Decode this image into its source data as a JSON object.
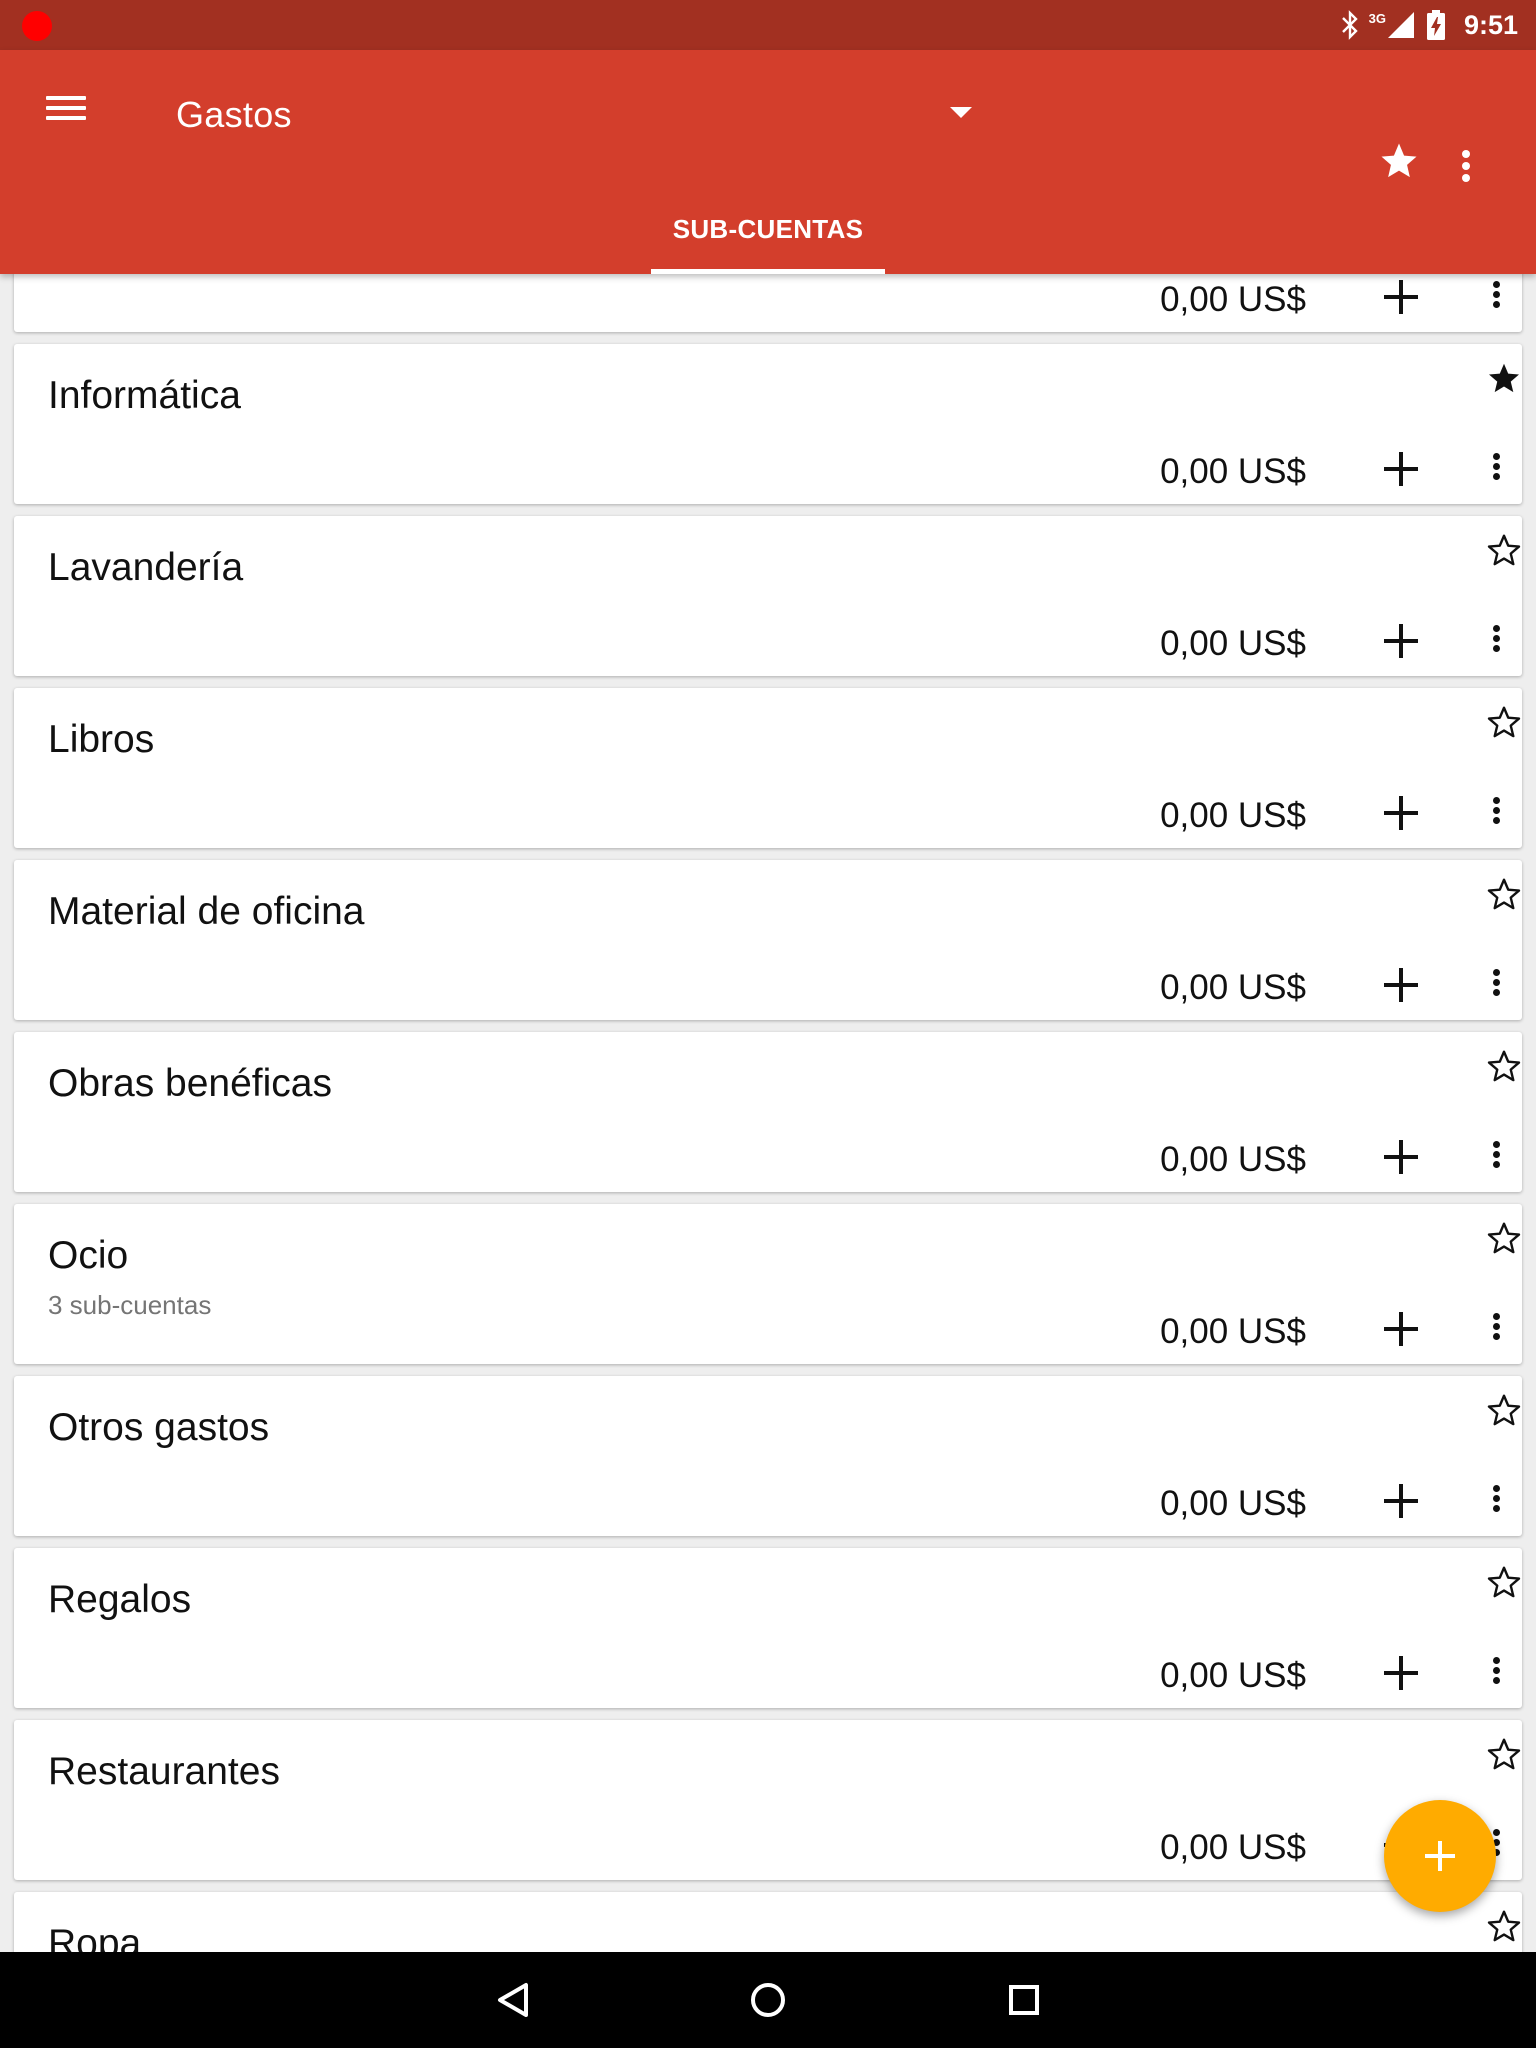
{
  "status_bar": {
    "time": "9:51",
    "network": "3G",
    "icons": [
      "recording-dot-icon",
      "bluetooth-icon",
      "signal-icon",
      "battery-charging-icon"
    ]
  },
  "app_bar": {
    "title": "Gastos",
    "icons": [
      "menu-icon",
      "dropdown-arrow-icon",
      "star-icon",
      "more-vert-icon"
    ],
    "tab": "SUB-CUENTAS"
  },
  "accounts": [
    {
      "name": "",
      "subtitle": "",
      "amount": "0,00 US$",
      "favorite": false
    },
    {
      "name": "Informática",
      "subtitle": "",
      "amount": "0,00 US$",
      "favorite": true
    },
    {
      "name": "Lavandería",
      "subtitle": "",
      "amount": "0,00 US$",
      "favorite": false
    },
    {
      "name": "Libros",
      "subtitle": "",
      "amount": "0,00 US$",
      "favorite": false
    },
    {
      "name": "Material de oficina",
      "subtitle": "",
      "amount": "0,00 US$",
      "favorite": false
    },
    {
      "name": "Obras benéficas",
      "subtitle": "",
      "amount": "0,00 US$",
      "favorite": false
    },
    {
      "name": "Ocio",
      "subtitle": "3 sub-cuentas",
      "amount": "0,00 US$",
      "favorite": false
    },
    {
      "name": "Otros gastos",
      "subtitle": "",
      "amount": "0,00 US$",
      "favorite": false
    },
    {
      "name": "Regalos",
      "subtitle": "",
      "amount": "0,00 US$",
      "favorite": false
    },
    {
      "name": "Restaurantes",
      "subtitle": "",
      "amount": "0,00 US$",
      "favorite": false
    },
    {
      "name": "Ropa",
      "subtitle": "",
      "amount": "",
      "favorite": false
    }
  ],
  "fab": {
    "icon": "add-icon"
  },
  "nav_bar": {
    "icons": [
      "back-icon",
      "home-icon",
      "recents-icon"
    ]
  },
  "colors": {
    "status_bar": "#a23021",
    "app_bar": "#d33e2c",
    "fab": "#ffab00",
    "recording_dot": "#ff0000"
  }
}
